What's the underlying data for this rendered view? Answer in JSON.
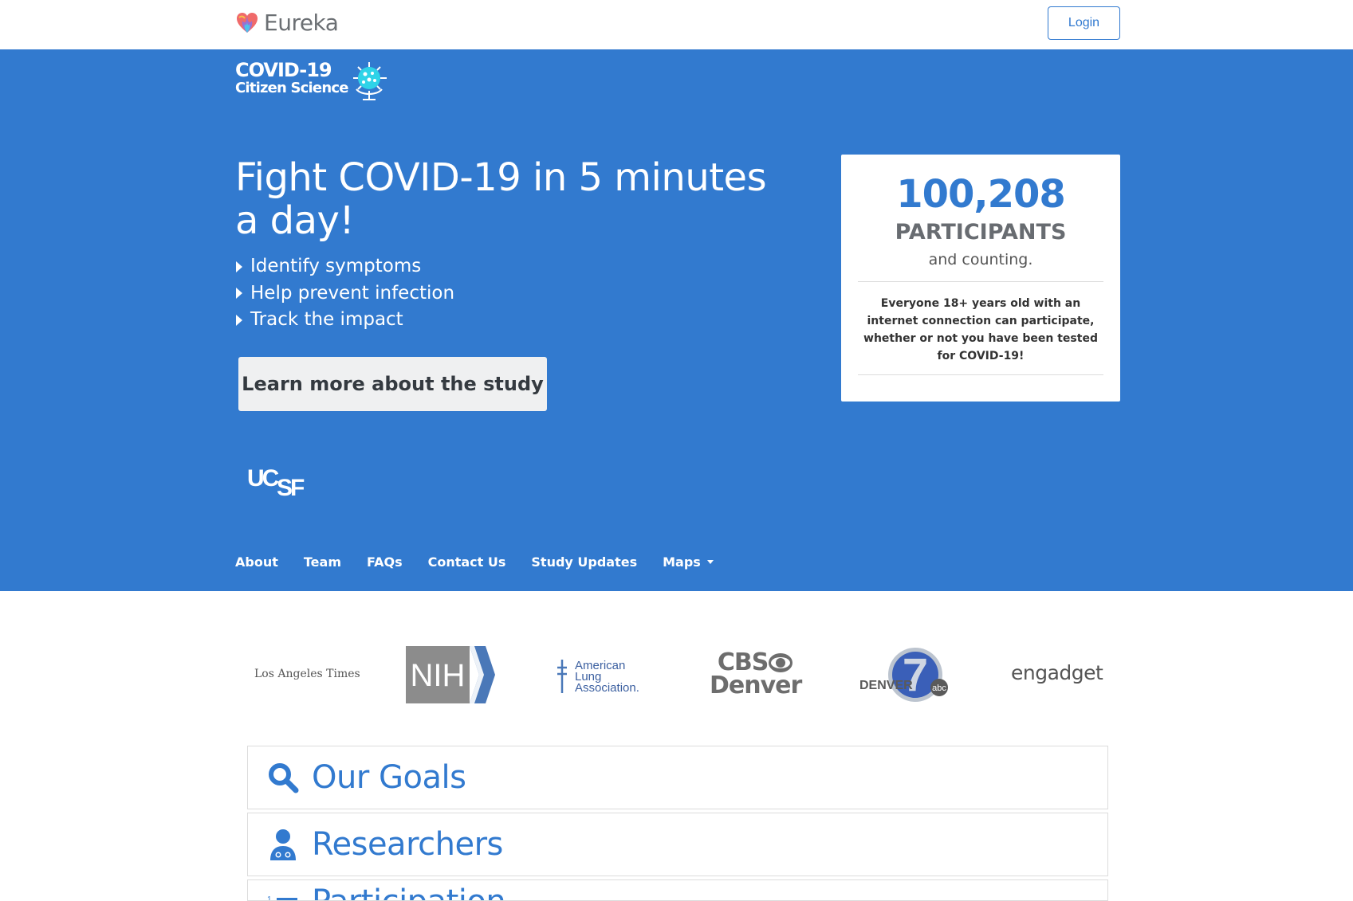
{
  "header": {
    "brand": "Eureka",
    "login_label": "Login"
  },
  "hero": {
    "logo_line1": "COVID-19",
    "logo_line2": "Citizen Science",
    "title": "Fight COVID-19 in 5 minutes a day!",
    "bullets": [
      "Identify symptoms",
      "Help prevent infection",
      "Track the impact"
    ],
    "cta_label": "Learn more about the study",
    "partner_logo": "UCSF",
    "nav": [
      "About",
      "Team",
      "FAQs",
      "Contact Us",
      "Study Updates",
      "Maps"
    ]
  },
  "stats_card": {
    "count": "100,208",
    "label": "PARTICIPANTS",
    "sub": "and counting.",
    "note": "Everyone 18+ years old with an internet connection can participate, whether or not you have been tested for COVID-19!"
  },
  "press": {
    "latimes": "Los Angeles Times",
    "nih": "NIH",
    "ala": [
      "American",
      "Lung",
      "Association."
    ],
    "cbs": [
      "CBS",
      "Denver"
    ],
    "denver7": [
      "DENVER",
      "abc"
    ],
    "engadget": "engadget"
  },
  "accordion": [
    "Our Goals",
    "Researchers",
    "Participation"
  ],
  "colors": {
    "primary": "#327acf",
    "button_bg": "#eff0f1",
    "muted": "#686c71"
  },
  "icons": {
    "goals": "search-icon",
    "researchers": "doctor-icon",
    "participation": "list-icon"
  }
}
